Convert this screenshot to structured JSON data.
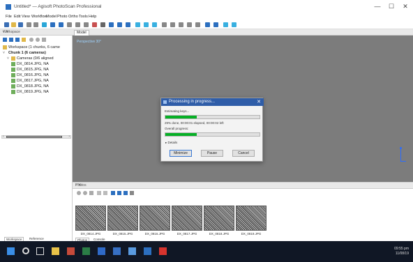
{
  "window": {
    "title": "Untitled* — Agisoft PhotoScan Professional",
    "controls": {
      "minimize": "—",
      "maximize": "☐",
      "close": "✕"
    }
  },
  "menu": [
    "File",
    "Edit",
    "View",
    "Workflow",
    "Model",
    "Photo",
    "Ortho",
    "Tools",
    "Help"
  ],
  "workspace": {
    "header": "Workspace",
    "tree": [
      {
        "label": "Workspace (1 chunks, 6 came"
      },
      {
        "label": "Chunk 1 (6 cameras)"
      },
      {
        "label": "Cameras (0/6 aligned"
      },
      {
        "label": "DX_0814.JPG, NA"
      },
      {
        "label": "DX_0815.JPG, NA"
      },
      {
        "label": "DX_0816.JPG, NA"
      },
      {
        "label": "DX_0817.JPG, NA"
      },
      {
        "label": "DX_0818.JPG, NA"
      },
      {
        "label": "DX_0819.JPG, NA"
      }
    ],
    "tabs": [
      "Workspace",
      "Reference"
    ]
  },
  "document": {
    "tab": "Model",
    "viewport_label": "Perspective 30°"
  },
  "dialog": {
    "title": "Processing in progress...",
    "stage_label": "Estimating keys...",
    "stage_progress": 0.33,
    "details_text": "29% done, 00:00:01 elapsed, 00:00:02 left",
    "overall_label": "Overall progress:",
    "overall_progress": 0.33,
    "details_toggle": "Details",
    "buttons": [
      "Minimize",
      "Pause",
      "Cancel"
    ]
  },
  "photos": {
    "header": "Photos",
    "items": [
      "DX_0814.JPG",
      "DX_0815.JPG",
      "DX_0816.JPG",
      "DX_0817.JPG",
      "DX_0818.JPG",
      "DX_0819.JPG"
    ],
    "tabs": [
      "Photos",
      "Console"
    ]
  },
  "taskbar": {
    "time": "09:55 pm",
    "date": "11/08/19"
  },
  "colors": {
    "progress": "#06b025",
    "dialog_title": "#2f5da8",
    "viewport": "#7c7c7c",
    "taskbar": "#101725"
  }
}
